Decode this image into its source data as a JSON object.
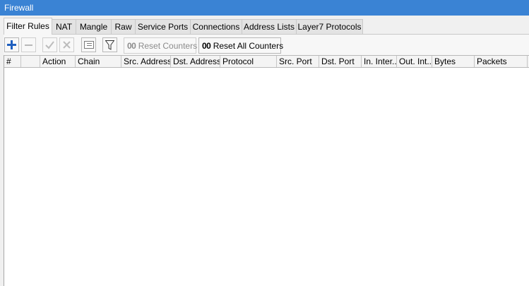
{
  "window": {
    "title": "Firewall"
  },
  "tabs": [
    {
      "label": "Filter Rules",
      "active": true
    },
    {
      "label": "NAT"
    },
    {
      "label": "Mangle"
    },
    {
      "label": "Raw"
    },
    {
      "label": "Service Ports"
    },
    {
      "label": "Connections"
    },
    {
      "label": "Address Lists"
    },
    {
      "label": "Layer7 Protocols"
    }
  ],
  "toolbar": {
    "add_icon": "plus-icon",
    "remove_icon": "minus-icon",
    "enable_icon": "check-icon",
    "disable_icon": "x-icon",
    "comment_icon": "comment-icon",
    "filter_icon": "funnel-icon",
    "reset_counters_prefix": "00",
    "reset_counters_label": "Reset Counters",
    "reset_all_prefix": "00",
    "reset_all_label": "Reset All Counters"
  },
  "table": {
    "columns": [
      "#",
      "",
      "Action",
      "Chain",
      "Src. Address",
      "Dst. Address",
      "Protocol",
      "Src. Port",
      "Dst. Port",
      "In. Inter...",
      "Out. Int...",
      "Bytes",
      "Packets"
    ],
    "rows": []
  },
  "colors": {
    "titlebar": "#3a83d4",
    "add_icon": "#1f5fbf"
  }
}
